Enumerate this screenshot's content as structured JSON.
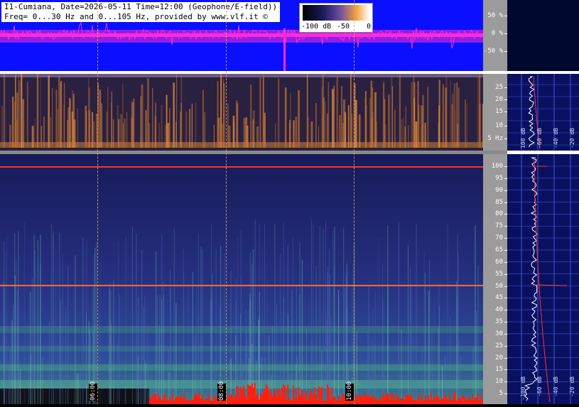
{
  "header": {
    "line1": "I1-Cumiana, Date=2026-05-11 Time=12:00 (Geophone/E-field))",
    "line2": "Freq= 0...30 Hz and 0...105 Hz, provided by www.vlf.it ©"
  },
  "colorbar": {
    "labels": [
      "-100 dB",
      "-50",
      "0"
    ]
  },
  "wave_axis": [
    "50 %",
    "0 %",
    "-50 %"
  ],
  "spec1_axis": [
    "25",
    "20",
    "15",
    "10",
    "5 Hz"
  ],
  "spec2_axis": [
    "100",
    "95",
    "90",
    "85",
    "80",
    "75",
    "70",
    "65",
    "60",
    "55",
    "50",
    "45",
    "40",
    "35",
    "30",
    "25",
    "20",
    "15",
    "10",
    "5"
  ],
  "time_labels": [
    "06:00",
    "08:00",
    "10:00"
  ],
  "side_labels_top": [
    "100 dB",
    "-60 dB",
    "-40 dB",
    "-20 dB"
  ],
  "side_labels_bottom": [
    "-100 dB",
    "-60 dB",
    "-40 dB",
    "-20 dB"
  ],
  "colors": {
    "wave_bg": "#0a10ff",
    "wave_signal": "#ff2bd6",
    "mains_line": "#ff3030",
    "side_bg": "#0a1060"
  }
}
